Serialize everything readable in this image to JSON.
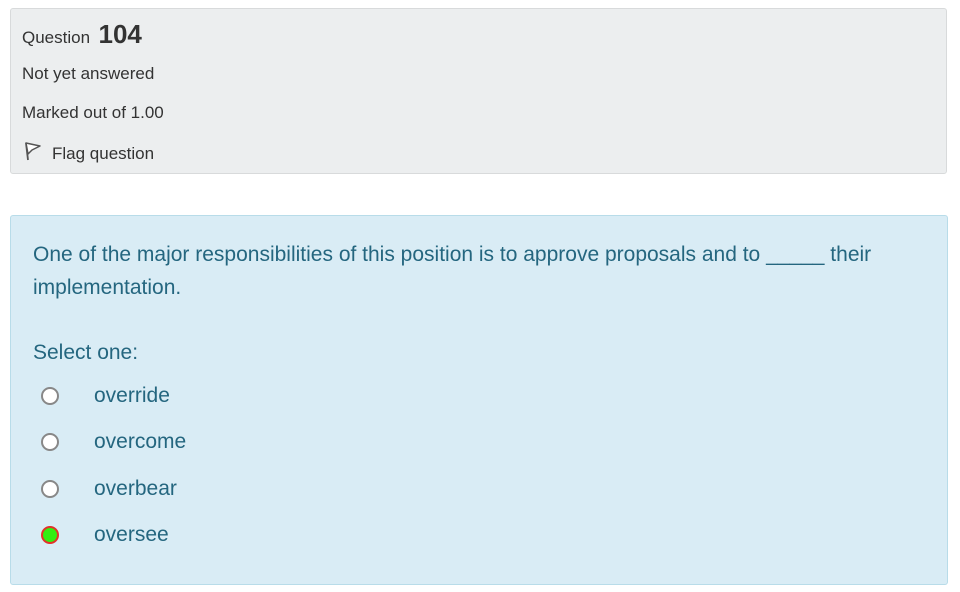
{
  "info": {
    "question_word": "Question",
    "question_number": "104",
    "state": "Not yet answered",
    "grade": "Marked out of 1.00",
    "flag_label": "Flag question"
  },
  "question": {
    "text": "One of the major responsibilities of this position is to approve proposals and to _____ their implementation.",
    "prompt": "Select one:",
    "options": [
      {
        "label": "override",
        "selected": false
      },
      {
        "label": "overcome",
        "selected": false
      },
      {
        "label": "overbear",
        "selected": false
      },
      {
        "label": "oversee",
        "selected": true
      }
    ]
  },
  "colors": {
    "info_background": "#eceeef",
    "content_background": "#d9ecf5",
    "text_accent": "#24667f",
    "selected_fill": "#33ee11",
    "selected_border": "#e0342a"
  },
  "icons": {
    "flag": "flag-outline-icon"
  }
}
